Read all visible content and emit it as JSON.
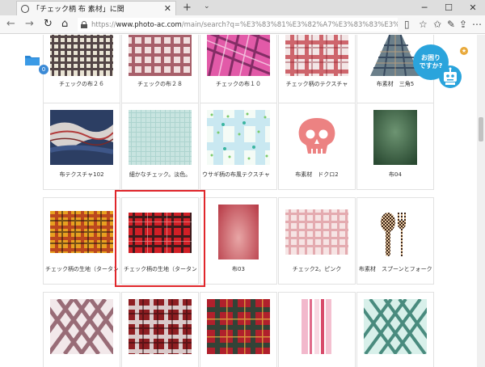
{
  "browser": {
    "tab_title": "「チェック柄 布 素材」に関",
    "url_prefix": "https://",
    "url_domain": "www.photo-ac.com",
    "url_path": "/main/search?q=%E3%83%81%E3%82%A7%E3%83%83%E3%82%AF%E6%9F%84%E3%80%80%E5%B8",
    "glyphs": {
      "back": "←",
      "forward": "→",
      "reload": "↻",
      "home": "⌂",
      "new_tab": "+",
      "tab_list": "⌄",
      "close": "✕",
      "minimize": "─",
      "maximize": "☐",
      "window_close": "✕",
      "reading": "▯",
      "favorite": "☆",
      "favorites_bar": "✩",
      "pen": "✎",
      "share": "⇪",
      "more": "⋯"
    }
  },
  "sidebar": {
    "download_count": "0"
  },
  "help_widget": {
    "bubble_text_1": "お困り",
    "bubble_text_2": "ですか?",
    "star": "★"
  },
  "grid": {
    "row1": [
      {
        "caption": "チェックの布２６"
      },
      {
        "caption": "チェックの布２８"
      },
      {
        "caption": "チェックの布１０"
      },
      {
        "caption": "チェック柄のテクスチャ"
      },
      {
        "caption": "布素材　三角5"
      }
    ],
    "row2": [
      {
        "caption": "布テクスチャ102"
      },
      {
        "caption": "細かなチェック。淡色。"
      },
      {
        "caption": "ウサギ柄の布風テクスチャ　緑"
      },
      {
        "caption": "布素材　ドクロ2"
      },
      {
        "caption": "布04"
      }
    ],
    "row3": [
      {
        "caption": "チェック柄の生地（タータンチェ…"
      },
      {
        "caption": "チェック柄の生地（タータンチェ…"
      },
      {
        "caption": "布03"
      },
      {
        "caption": "チェック2。ピンク"
      },
      {
        "caption": "布素材　スプーンとフォーク1"
      }
    ],
    "row4": [
      {
        "caption": ""
      },
      {
        "caption": ""
      },
      {
        "caption": ""
      },
      {
        "caption": ""
      },
      {
        "caption": ""
      }
    ]
  },
  "selected_item_caption": "チェック柄の生地（タータンチェ…",
  "colors": {
    "selection_border": "#e0262b",
    "accent_blue": "#2aa4dc",
    "badge_blue": "#3b8ad6"
  }
}
